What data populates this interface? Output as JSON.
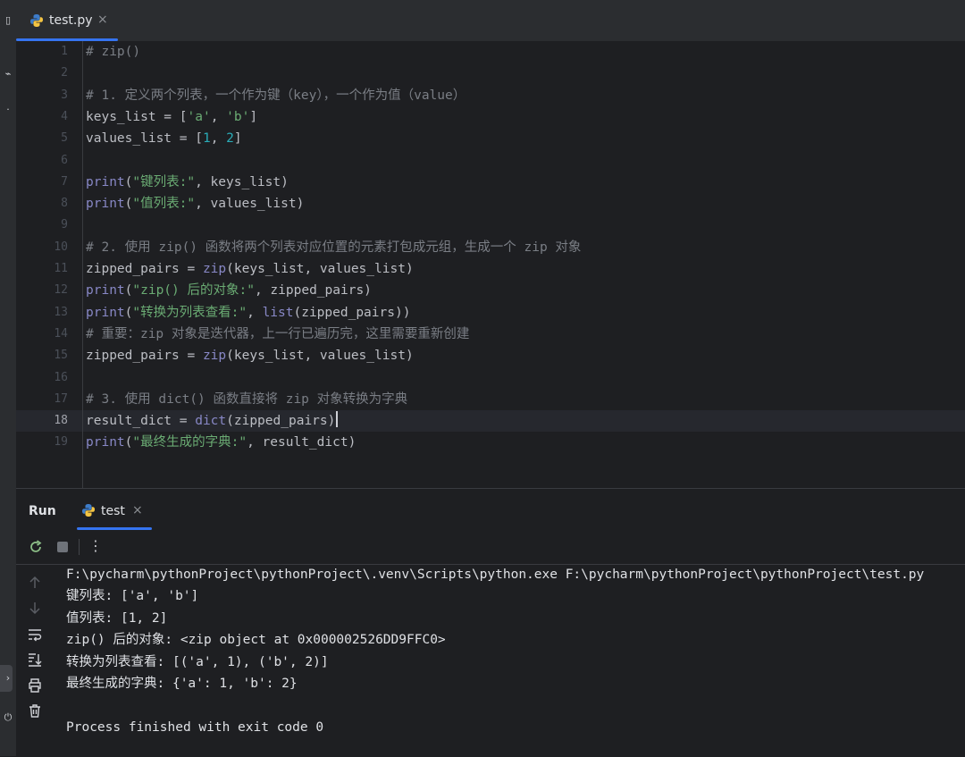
{
  "editor_tab": {
    "filename": "test.py",
    "close": "×"
  },
  "editor": {
    "line_numbers": [
      "1",
      "2",
      "3",
      "4",
      "5",
      "6",
      "7",
      "8",
      "9",
      "10",
      "11",
      "12",
      "13",
      "14",
      "15",
      "16",
      "17",
      "18",
      "19"
    ],
    "current_line": "18",
    "lines": [
      [
        {
          "t": "# zip()",
          "c": "cm"
        }
      ],
      [],
      [
        {
          "t": "# 1. 定义两个列表，一个作为键（key），一个作为值（value）",
          "c": "cm"
        }
      ],
      [
        {
          "t": "keys_list = [",
          "c": "id"
        },
        {
          "t": "'a'",
          "c": "str"
        },
        {
          "t": ", ",
          "c": "id"
        },
        {
          "t": "'b'",
          "c": "str"
        },
        {
          "t": "]",
          "c": "id"
        }
      ],
      [
        {
          "t": "values_list = [",
          "c": "id"
        },
        {
          "t": "1",
          "c": "num"
        },
        {
          "t": ", ",
          "c": "id"
        },
        {
          "t": "2",
          "c": "num"
        },
        {
          "t": "]",
          "c": "id"
        }
      ],
      [],
      [
        {
          "t": "print",
          "c": "fn"
        },
        {
          "t": "(",
          "c": "id"
        },
        {
          "t": "\"键列表:\"",
          "c": "str"
        },
        {
          "t": ", keys_list)",
          "c": "id"
        }
      ],
      [
        {
          "t": "print",
          "c": "fn"
        },
        {
          "t": "(",
          "c": "id"
        },
        {
          "t": "\"值列表:\"",
          "c": "str"
        },
        {
          "t": ", values_list)",
          "c": "id"
        }
      ],
      [],
      [
        {
          "t": "# 2. 使用 zip() 函数将两个列表对应位置的元素打包成元组，生成一个 zip 对象",
          "c": "cm"
        }
      ],
      [
        {
          "t": "zipped_pairs = ",
          "c": "id"
        },
        {
          "t": "zip",
          "c": "fn"
        },
        {
          "t": "(keys_list, values_list)",
          "c": "id"
        }
      ],
      [
        {
          "t": "print",
          "c": "fn"
        },
        {
          "t": "(",
          "c": "id"
        },
        {
          "t": "\"zip() 后的对象:\"",
          "c": "str"
        },
        {
          "t": ", zipped_pairs)",
          "c": "id"
        }
      ],
      [
        {
          "t": "print",
          "c": "fn"
        },
        {
          "t": "(",
          "c": "id"
        },
        {
          "t": "\"转换为列表查看:\"",
          "c": "str"
        },
        {
          "t": ", ",
          "c": "id"
        },
        {
          "t": "list",
          "c": "fn"
        },
        {
          "t": "(zipped_pairs))",
          "c": "id"
        }
      ],
      [
        {
          "t": "# 重要：zip 对象是迭代器，上一行已遍历完，这里需要重新创建",
          "c": "cm"
        }
      ],
      [
        {
          "t": "zipped_pairs = ",
          "c": "id"
        },
        {
          "t": "zip",
          "c": "fn"
        },
        {
          "t": "(keys_list, values_list)",
          "c": "id"
        }
      ],
      [],
      [
        {
          "t": "# 3. 使用 dict() 函数直接将 zip 对象转换为字典",
          "c": "cm"
        }
      ],
      [
        {
          "t": "result_dict = ",
          "c": "id"
        },
        {
          "t": "dict",
          "c": "fn"
        },
        {
          "t": "(zipped_pairs)",
          "c": "id"
        }
      ],
      [
        {
          "t": "print",
          "c": "fn"
        },
        {
          "t": "(",
          "c": "id"
        },
        {
          "t": "\"最终生成的字典:\"",
          "c": "str"
        },
        {
          "t": ", result_dict)",
          "c": "id"
        }
      ]
    ]
  },
  "run_panel": {
    "title": "Run",
    "tab_label": "test",
    "tab_close": "×",
    "more_label": "⋮",
    "console_lines": [
      "F:\\pycharm\\pythonProject\\pythonProject\\.venv\\Scripts\\python.exe F:\\pycharm\\pythonProject\\pythonProject\\test.py",
      "键列表: ['a', 'b']",
      "值列表: [1, 2]",
      "zip() 后的对象: <zip object at 0x000002526DD9FFC0>",
      "转换为列表查看: [('a', 1), ('b', 2)]",
      "最终生成的字典: {'a': 1, 'b': 2}",
      "",
      "Process finished with exit code 0"
    ]
  },
  "colors": {
    "background": "#1e1f22",
    "panel": "#2b2d30",
    "accent": "#3574f0",
    "comment": "#7a7e85",
    "builtin": "#8888c6",
    "string": "#6aab73",
    "number": "#2aacb8"
  },
  "icons": [
    "python-file-icon",
    "rerun-icon",
    "stop-icon",
    "more-icon",
    "scroll-up-icon",
    "scroll-down-icon",
    "soft-wrap-icon",
    "scroll-to-end-icon",
    "print-icon",
    "trash-icon"
  ]
}
